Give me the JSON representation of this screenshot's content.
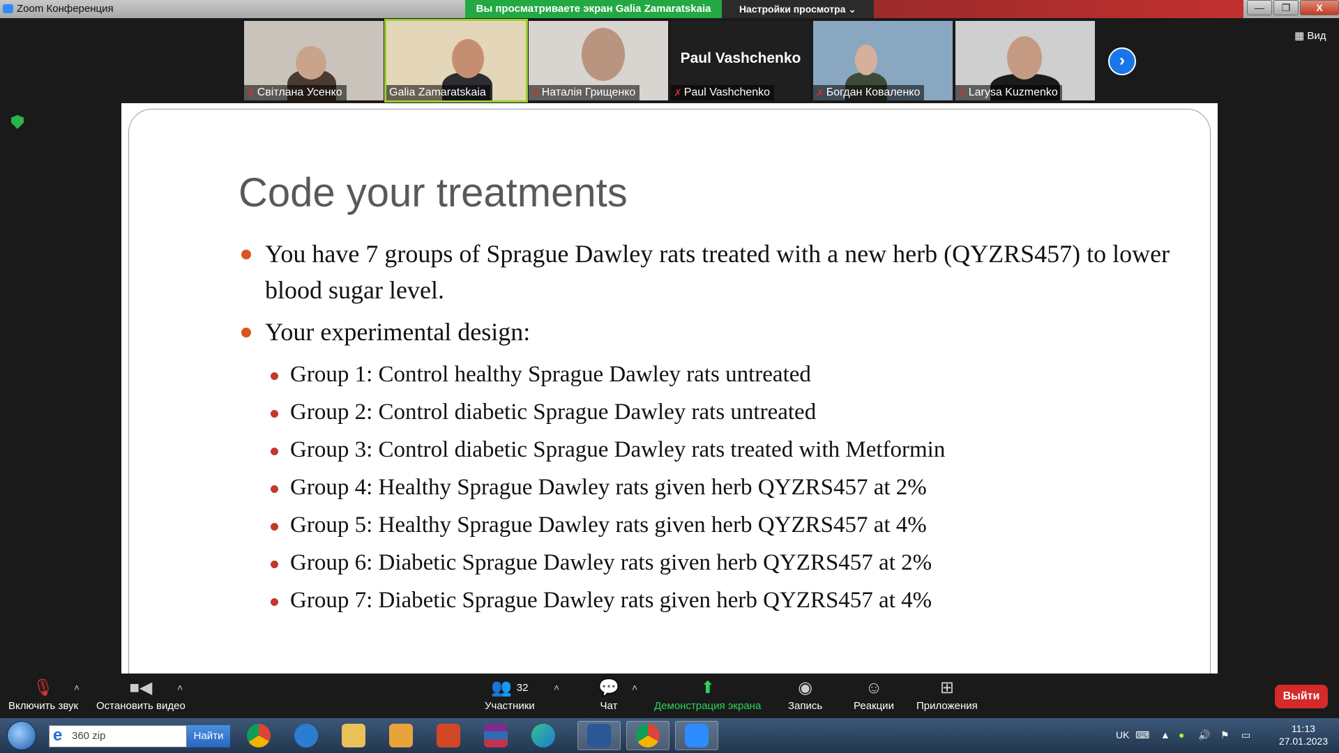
{
  "window": {
    "title": "Zoom Конференция",
    "share_banner": "Вы просматриваете экран Galia Zamaratskaia",
    "view_options": "Настройки просмотра ⌄",
    "minimize": "—",
    "maximize": "❐",
    "close": "X"
  },
  "participants": [
    {
      "name": "Світлана Усенко",
      "muted": true
    },
    {
      "name": "Galia Zamaratskaia",
      "muted": false
    },
    {
      "name": "Наталія Грищенко",
      "muted": true
    },
    {
      "name": "Paul Vashchenko",
      "muted": true,
      "display_name": "Paul Vashchenko"
    },
    {
      "name": "Богдан Коваленко",
      "muted": true
    },
    {
      "name": "Larysa Kuzmenko",
      "muted": true
    }
  ],
  "view_button": "Вид",
  "slide": {
    "title": "Code your treatments",
    "bullets": [
      "You have 7 groups of Sprague Dawley rats treated with a new herb (QYZRS457) to lower blood sugar level.",
      "Your experimental design:"
    ],
    "groups": [
      "Group 1: Control healthy Sprague Dawley rats untreated",
      "Group 2: Control diabetic Sprague Dawley rats untreated",
      "Group 3: Control diabetic Sprague Dawley rats treated with Metformin",
      "Group 4: Healthy Sprague Dawley rats given herb QYZRS457 at 2%",
      "Group 5: Healthy Sprague Dawley rats given herb QYZRS457 at 4%",
      "Group 6: Diabetic Sprague Dawley rats given herb QYZRS457 at 2%",
      "Group 7: Diabetic Sprague Dawley rats given herb QYZRS457 at 4%"
    ]
  },
  "toolbar": {
    "unmute": "Включить звук",
    "stop_video": "Остановить видео",
    "participants": "Участники",
    "participants_count": "32",
    "chat": "Чат",
    "share_screen": "Демонстрация экрана",
    "record": "Запись",
    "reactions": "Реакции",
    "apps": "Приложения",
    "exit": "Выйти"
  },
  "taskbar": {
    "search_value": "360 zip",
    "find_button": "Найти",
    "language": "UK",
    "time": "11:13",
    "date": "27.01.2023"
  },
  "colors": {
    "share_banner": "#23a943",
    "bullet_orange": "#d9541e",
    "exit_red": "#d42a2a",
    "accent_blue": "#1976e8"
  }
}
